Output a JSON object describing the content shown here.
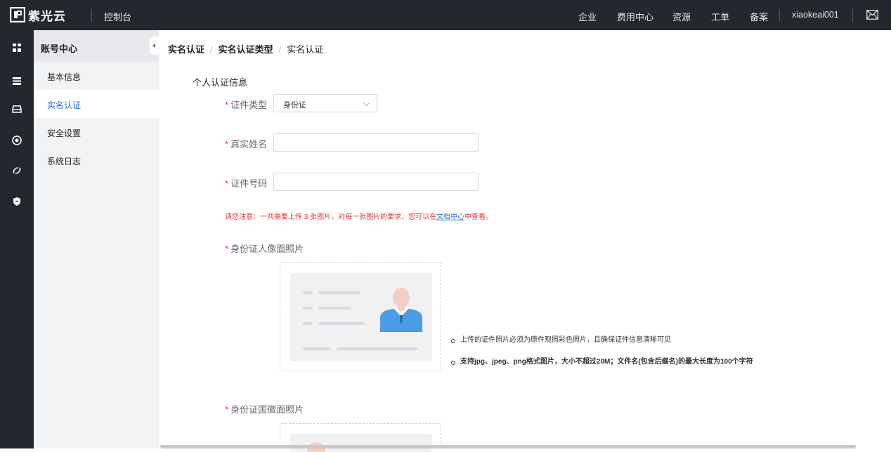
{
  "header": {
    "brand": "紫光云",
    "console": "控制台",
    "nav": [
      "企业",
      "费用中心",
      "资源",
      "工单",
      "备案"
    ],
    "username": "xiaokeai001",
    "mail_icon": "mail-icon",
    "bg_color": "#23272e"
  },
  "rail": {
    "icons": [
      "grid-icon",
      "server-icon",
      "storage-icon",
      "security-icon",
      "network-icon",
      "shield-icon"
    ]
  },
  "sidebar": {
    "title": "账号中心",
    "items": [
      {
        "label": "基本信息",
        "active": false
      },
      {
        "label": "实名认证",
        "active": true
      },
      {
        "label": "安全设置",
        "active": false
      },
      {
        "label": "系统日志",
        "active": false
      }
    ],
    "active_color": "#2f6fe4"
  },
  "breadcrumb": [
    "实名认证",
    "实名认证类型",
    "实名认证"
  ],
  "form": {
    "section_title": "个人认证信息",
    "required_mark": "*",
    "id_type": {
      "label": "证件类型",
      "value": "身份证"
    },
    "real_name": {
      "label": "真实姓名",
      "value": ""
    },
    "id_number": {
      "label": "证件号码",
      "value": ""
    },
    "notice_before": "请您注意：一共需要上传 3 张图片，对每一张图片的要求，您可以在",
    "notice_link": "文档中心",
    "notice_after": "中查看。",
    "front_photo_label": "身份证人像面照片",
    "back_photo_label": "身份证国徽面照片",
    "tips": [
      "上传的证件照片必须为原件现照彩色照片，且确保证件信息清晰可见",
      "支持jpg、jpeg、png格式图片，大小不超过20M；文件名(包含后缀名)的最大长度为100个字符"
    ]
  }
}
